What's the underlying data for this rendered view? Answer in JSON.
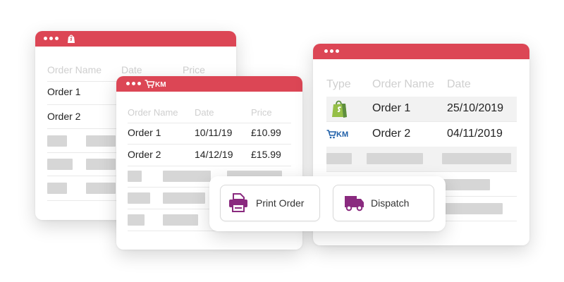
{
  "shopify_window": {
    "headers": {
      "name": "Order Name",
      "date": "Date",
      "price": "Price"
    },
    "rows": [
      {
        "name": "Order 1"
      },
      {
        "name": "Order 2"
      }
    ]
  },
  "ekm_window": {
    "headers": {
      "name": "Order Name",
      "date": "Date",
      "price": "Price"
    },
    "rows": [
      {
        "name": "Order 1",
        "date": "10/11/19",
        "price": "£10.99"
      },
      {
        "name": "Order 2",
        "date": "14/12/19",
        "price": "£15.99"
      }
    ]
  },
  "combined_window": {
    "headers": {
      "type": "Type",
      "name": "Order Name",
      "date": "Date"
    },
    "rows": [
      {
        "type_icon": "shopify-bag-icon",
        "name": "Order 1",
        "date": "25/10/2019"
      },
      {
        "type_icon": "ekm-cart-icon",
        "name": "Order 2",
        "date": "04/11/2019"
      }
    ]
  },
  "actions": {
    "print_label": "Print Order",
    "dispatch_label": "Dispatch"
  },
  "colors": {
    "titlebar": "#dc4655",
    "shopify_green": "#95bf47",
    "ekm_blue": "#1f5fa8",
    "action_purple": "#8a2a7f"
  },
  "icons": {
    "print": "printer-icon",
    "dispatch": "truck-icon"
  }
}
